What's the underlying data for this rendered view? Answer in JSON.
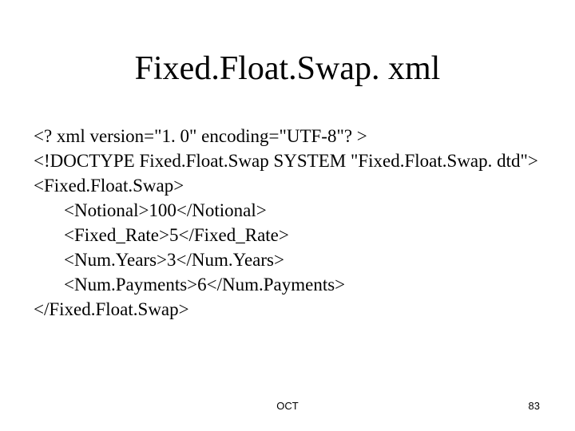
{
  "title": "Fixed.Float.Swap. xml",
  "code": {
    "l1": "<? xml version=\"1. 0\" encoding=\"UTF-8\"? >",
    "l2": "<!DOCTYPE Fixed.Float.Swap SYSTEM \"Fixed.Float.Swap. dtd\">",
    "l3": "<Fixed.Float.Swap>",
    "l4": "<Notional>100</Notional>",
    "l5": "<Fixed_Rate>5</Fixed_Rate>",
    "l6": "<Num.Years>3</Num.Years>",
    "l7": "<Num.Payments>6</Num.Payments>",
    "l8": "</Fixed.Float.Swap>"
  },
  "footer": {
    "center": "OCT",
    "page": "83"
  }
}
